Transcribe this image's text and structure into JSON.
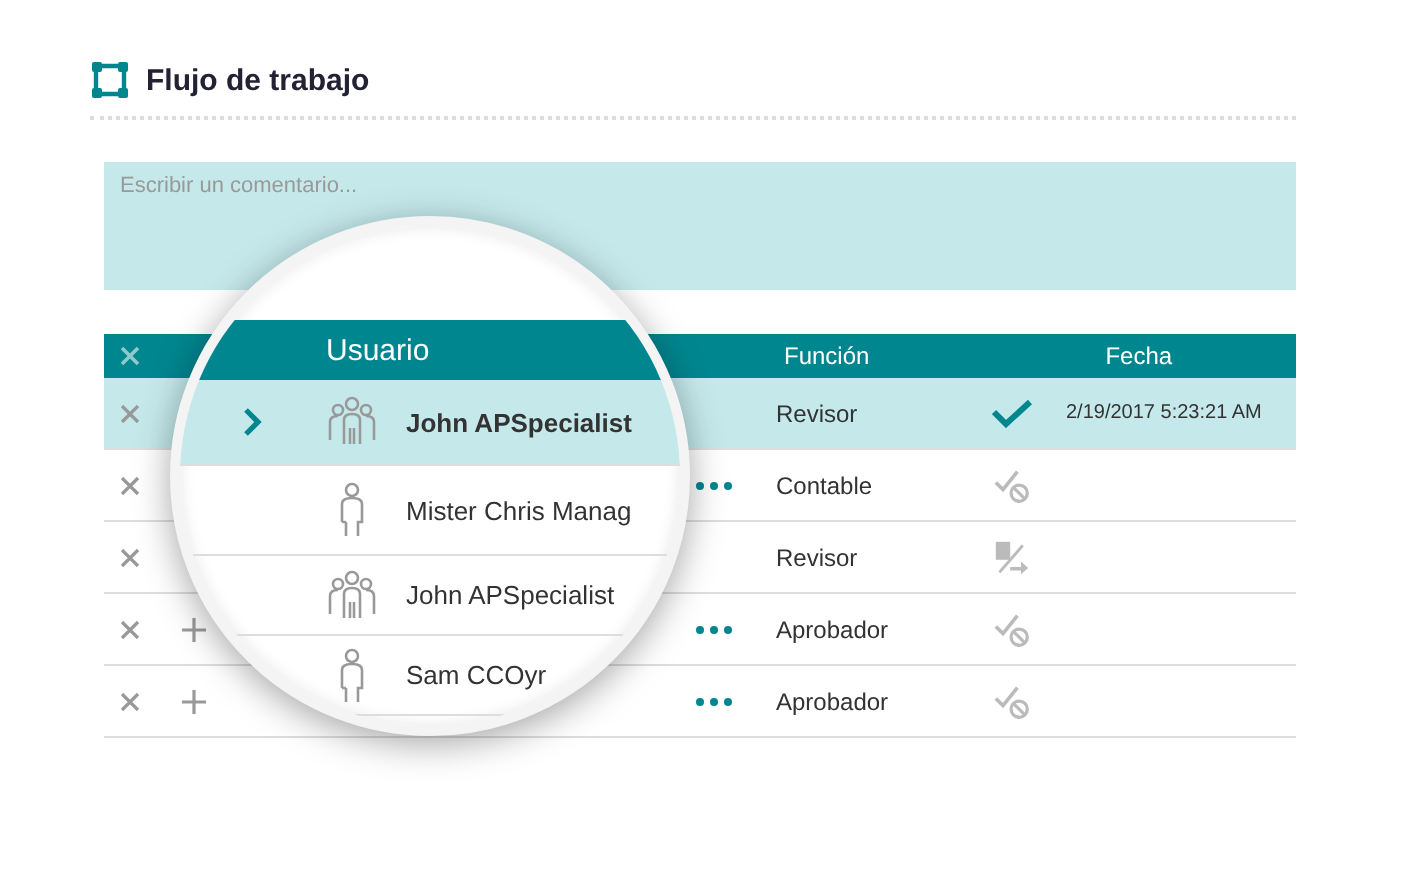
{
  "title": "Flujo de trabajo",
  "comment": {
    "placeholder": "Escribir un comentario..."
  },
  "table": {
    "columns": {
      "user": "Usuario",
      "function": "Función",
      "date": "Fecha"
    },
    "rows": [
      {
        "selected": true,
        "menu": false,
        "user": {
          "name": "John APSpecialist",
          "kind": "group"
        },
        "function": "Revisor",
        "status": {
          "kind": "approved"
        },
        "date": "2/19/2017 5:23:21 AM"
      },
      {
        "selected": false,
        "menu": true,
        "user": {
          "name": "Mister Chris Manag",
          "kind": "person"
        },
        "function": "Contable",
        "status": {
          "kind": "pending"
        }
      },
      {
        "selected": false,
        "menu": false,
        "function": "Revisor",
        "status": {
          "kind": "calculator"
        }
      },
      {
        "selected": false,
        "menu": true,
        "user": {
          "name": "John APSpecialist",
          "kind": "group"
        },
        "function": "Aprobador",
        "status": {
          "kind": "pending"
        }
      },
      {
        "selected": false,
        "menu": true,
        "user": {
          "name": "Sam CCOyr",
          "kind": "person"
        },
        "function": "Aprobador",
        "status": {
          "kind": "pending"
        }
      }
    ]
  }
}
